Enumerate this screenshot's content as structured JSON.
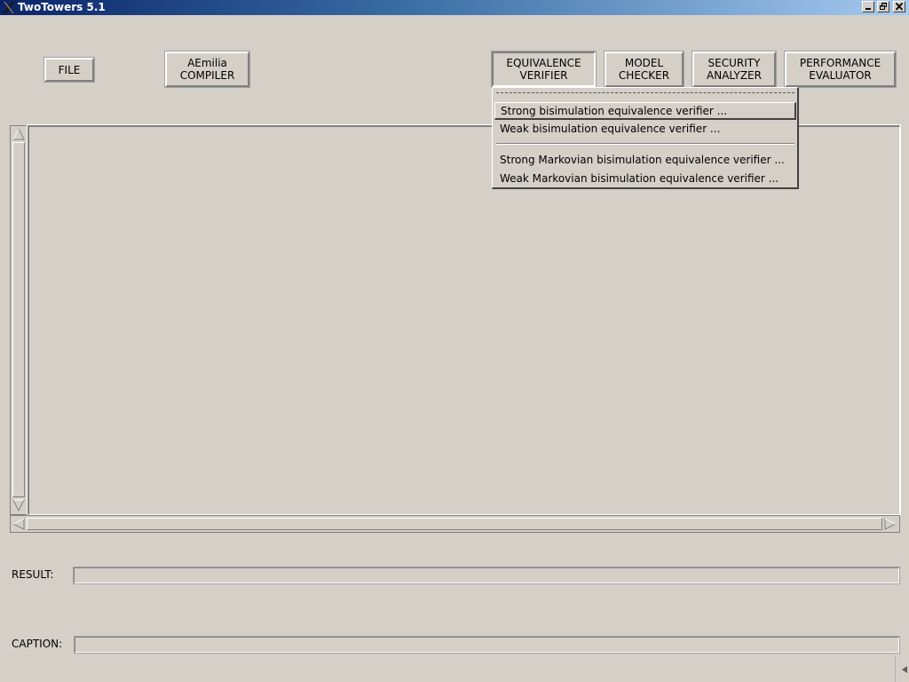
{
  "window": {
    "title": "TwoTowers 5.1"
  },
  "toolbar": {
    "file": "FILE",
    "aemilia_compiler": "AEmilia\nCOMPILER",
    "equivalence_verifier": "EQUIVALENCE\nVERIFIER",
    "model_checker": "MODEL\nCHECKER",
    "security_analyzer": "SECURITY\nANALYZER",
    "performance_evaluator": "PERFORMANCE\nEVALUATOR"
  },
  "equivalence_menu": {
    "items": [
      "Strong bisimulation equivalence verifier ...",
      "Weak bisimulation equivalence verifier ...",
      "Strong Markovian bisimulation equivalence verifier ...",
      "Weak Markovian bisimulation equivalence verifier ..."
    ],
    "active_index": 0
  },
  "result": {
    "label": "RESULT:",
    "value": ""
  },
  "caption": {
    "label": "CAPTION:",
    "value": ""
  },
  "colors": {
    "face": "#d4d0c8",
    "titlebar_start": "#0a246a",
    "titlebar_end": "#a6caf0",
    "shadow": "#808080",
    "highlight": "#ffffff"
  }
}
